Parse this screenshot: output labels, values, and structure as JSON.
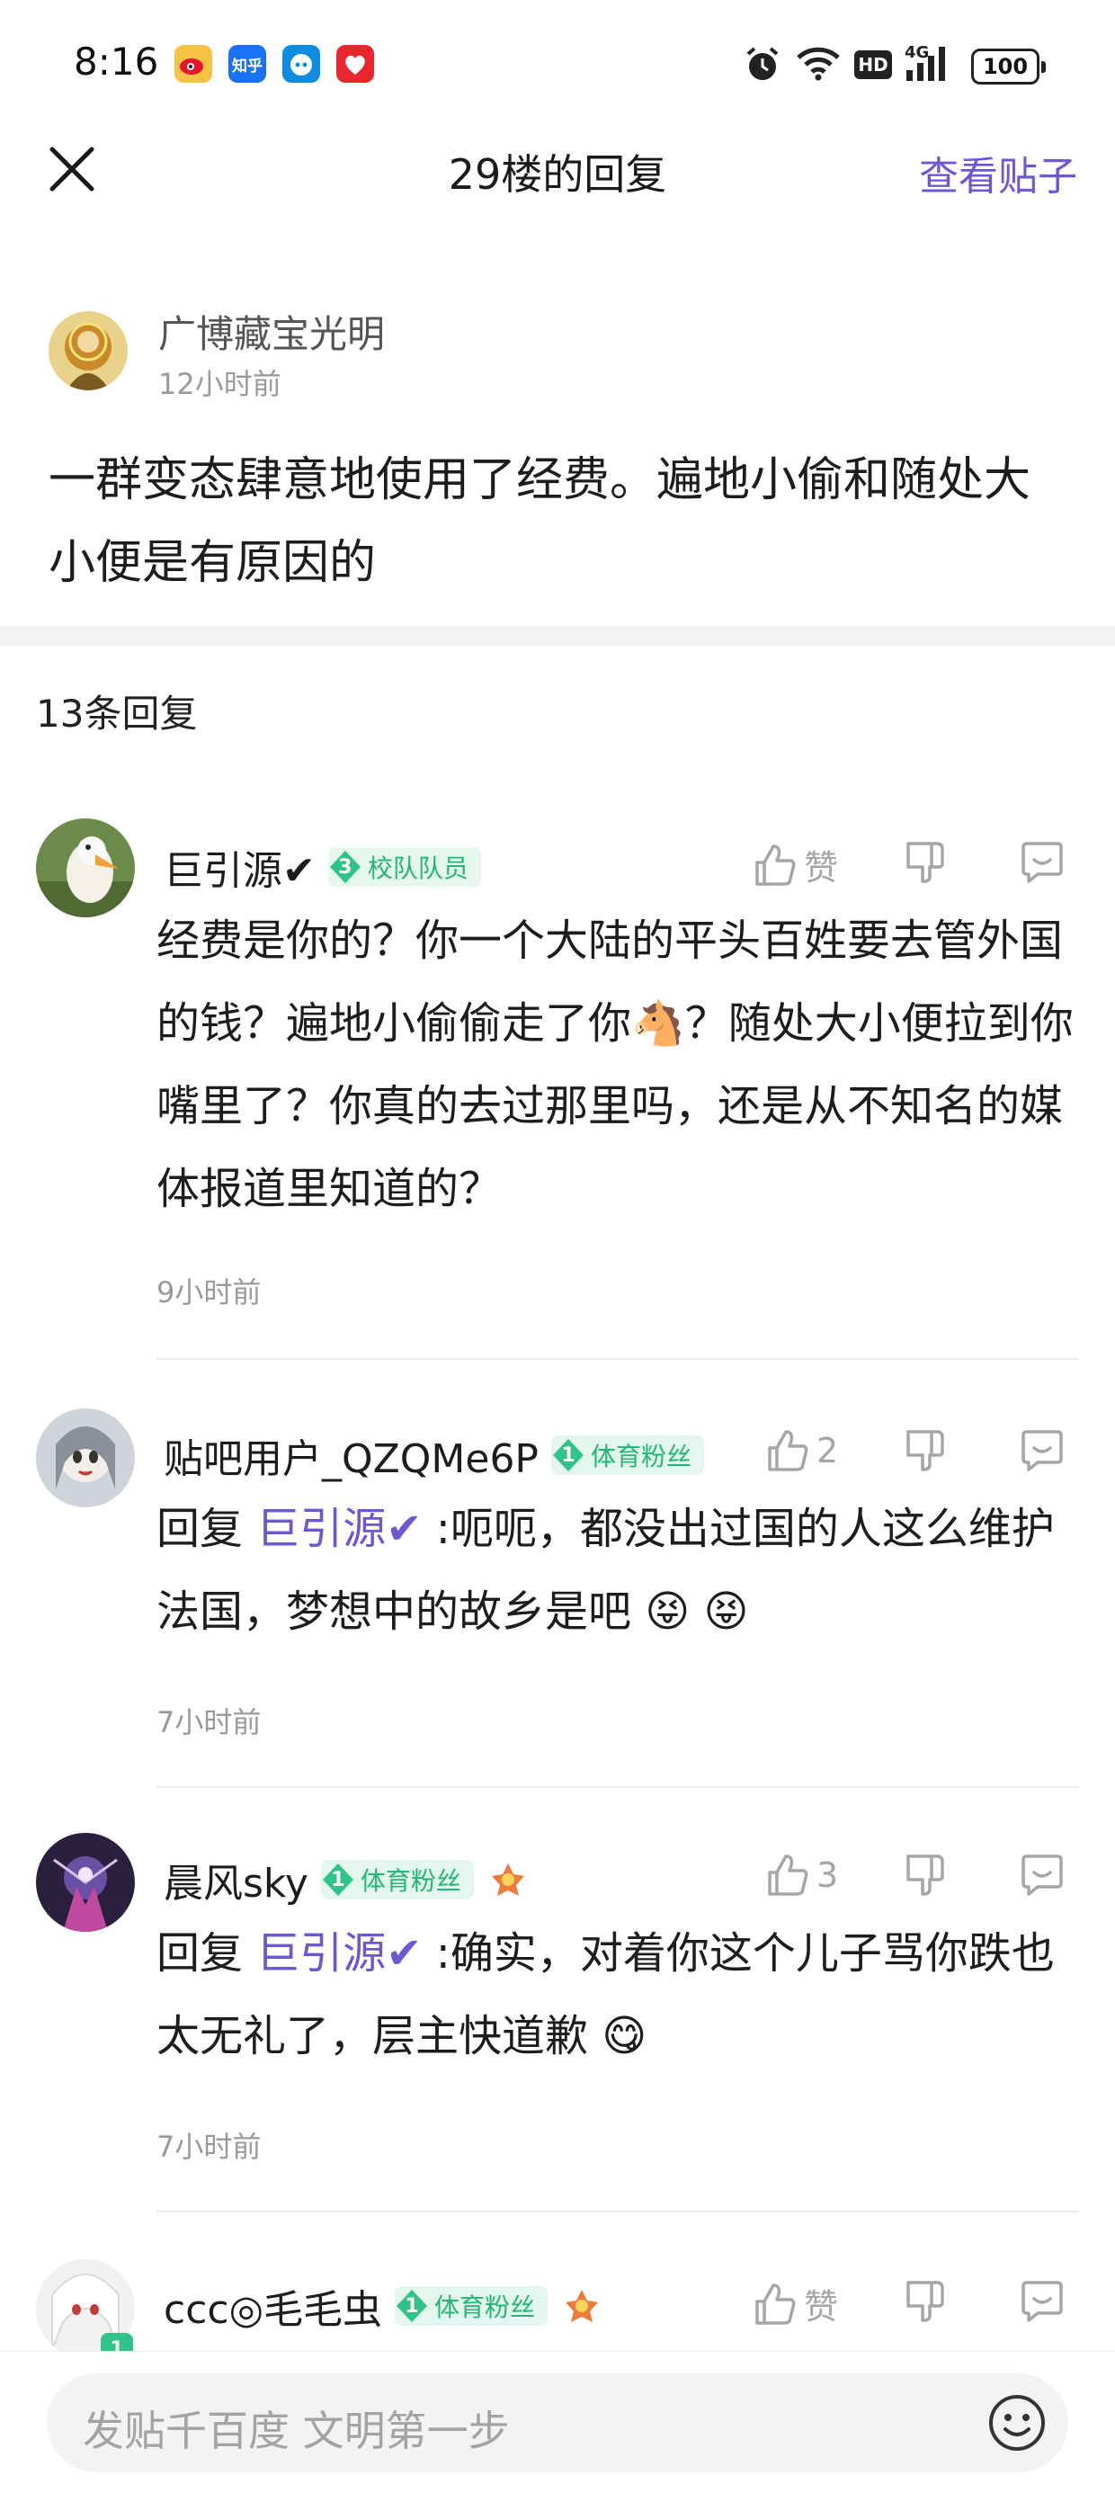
{
  "status_bar": {
    "time": "8:16",
    "apps": [
      "weibo-icon",
      "zhihu-icon",
      "bilibili-icon",
      "xiaohongshu-icon"
    ],
    "zhihu_label": "知乎",
    "network": "4G",
    "hd": "HD",
    "battery": "100"
  },
  "header": {
    "title": "29楼的回复",
    "view_post": "查看贴子"
  },
  "main_post": {
    "author": "广博藏宝光明",
    "time": "12小时前",
    "text": "一群变态肆意地使用了经费。遍地小偷和随处大小便是有原因的"
  },
  "reply_count": "13条回复",
  "replies": [
    {
      "name": "巨引源✔",
      "badge_level": "3",
      "badge_text": "校队队员",
      "like_label": "赞",
      "body": "经费是你的？你一个大陆的平头百姓要去管外国的钱？遍地小偷偷走了你🐴？随处大小便拉到你嘴里了？你真的去过那里吗，还是从不知名的媒体报道里知道的？",
      "time": "9小时前"
    },
    {
      "name": "贴吧用户_QZQMe6P",
      "badge_level": "1",
      "badge_text": "体育粉丝",
      "like_label": "2",
      "reply_prefix": "回复 ",
      "mention": "巨引源✔",
      "body": " :呃呃，都没出过国的人这么维护法国，梦想中的故乡是吧 😝 😝",
      "time": "7小时前"
    },
    {
      "name": "晨风sky",
      "badge_level": "1",
      "badge_text": "体育粉丝",
      "like_label": "3",
      "reply_prefix": "回复 ",
      "mention": "巨引源✔",
      "body": " :确实，对着你这个儿子骂你跌也太无礼了，层主快道歉 😋",
      "time": "7小时前"
    },
    {
      "name": "ccc◎毛毛虫",
      "badge_level": "1",
      "badge_text": "体育粉丝",
      "like_label": "赞",
      "avatar_level": "1"
    }
  ],
  "input": {
    "placeholder": "发贴千百度 文明第一步"
  },
  "colors": {
    "accent": "#6f57d4",
    "badge_green": "#23b57c",
    "badge_bg": "#e3f7ef",
    "muted": "#9a9a9a"
  }
}
